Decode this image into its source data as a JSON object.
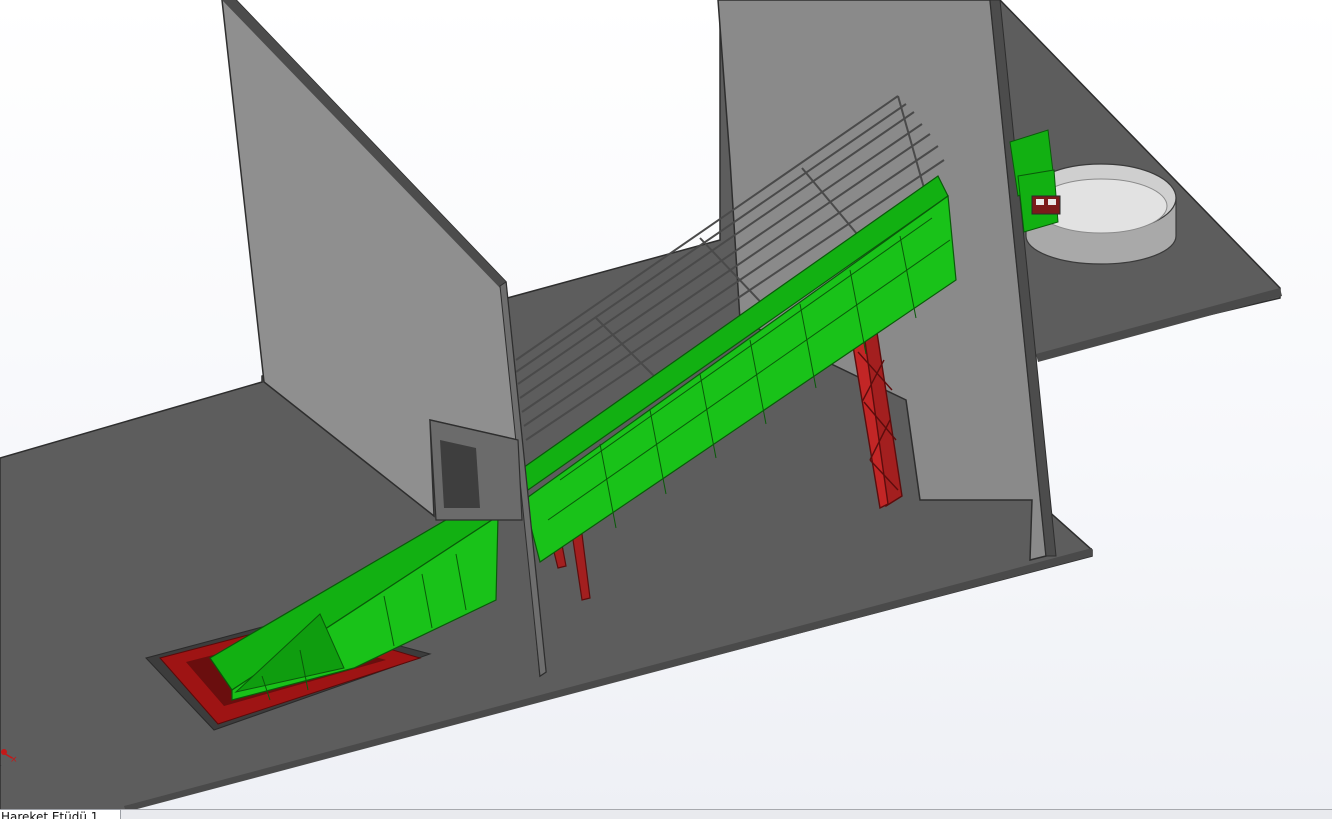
{
  "viewport": {
    "background": "#ffffff",
    "colors": {
      "floor": "#5d5d5d",
      "wall": "#8a8a8a",
      "edge": "#2e2e2e",
      "conveyor": "#12b012",
      "conveyor_dark": "#0c7d0c",
      "support": "#a31f1f",
      "pit": "#9e1414",
      "tank": "#bcbcbc"
    }
  },
  "triad": {
    "name": "axis-triad-icon"
  },
  "tabbar": {
    "active_tab": "Hareket Etüdü 1"
  }
}
